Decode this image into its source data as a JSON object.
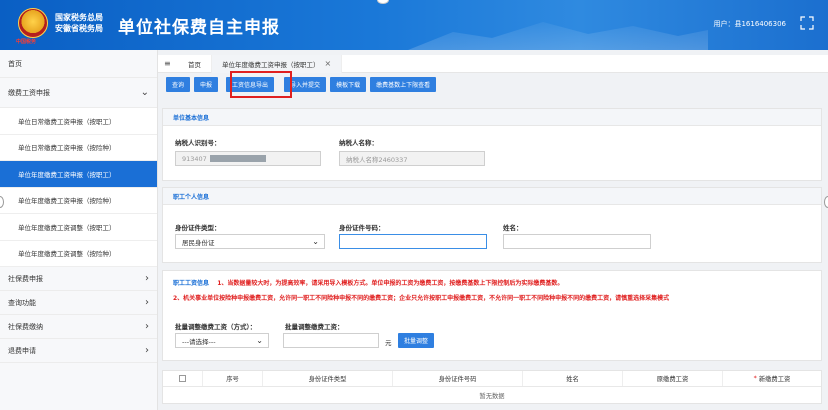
{
  "header": {
    "org_line1": "国家税务总局",
    "org_line2": "安徽省税务局",
    "emblem_subtitle": "中国税务",
    "title": "单位社保费自主申报",
    "user": "用户：县1616406306"
  },
  "sidebar": {
    "home": "首页",
    "group_title": "缴费工资申报",
    "sub_items": [
      "单位日常缴费工资申报（按职工）",
      "单位日常缴费工资申报（按险种）",
      "单位年度缴费工资申报（按职工）",
      "单位年度缴费工资申报（按险种）",
      "单位年度缴费工资调整（按职工）",
      "单位年度缴费工资调整（按险种）"
    ],
    "active_index": 2,
    "collapsed_groups": [
      "社保费申报",
      "查询功能",
      "社保费缴纳",
      "退费申请"
    ]
  },
  "tabs": {
    "home": "首页",
    "active": "单位年度缴费工资申报（按职工）"
  },
  "toolbar": {
    "buttons": [
      "查询",
      "申报",
      "工资信息导出",
      "导入并提交",
      "模板下载",
      "缴费基数上下限查看"
    ],
    "highlighted": "工资信息导出"
  },
  "unit_info": {
    "title": "单位基本信息",
    "taxpayer_id_label": "纳税人识别号：",
    "taxpayer_id_value": "913407",
    "taxpayer_name_label": "纳税人名称：",
    "taxpayer_name_placeholder": "纳税人名称2460337"
  },
  "personal_info": {
    "title": "职工个人信息",
    "id_type_label": "身份证件类型：",
    "id_type_value": "居民身份证",
    "id_no_label": "身份证件号码：",
    "name_label": "姓名："
  },
  "wage_info": {
    "title": "职工工资信息",
    "notice1": "1、当数据量较大时，为提高效率，请采用导入模板方式。单位申报的工资为缴费工资，按缴费基数上下限控制后为实际缴费基数。",
    "notice2": "2、机关事业单位按险种申报缴费工资，允许同一职工不同险种申报不同的缴费工资；企业只允许按职工申报缴费工资，不允许同一职工不同险种申报不同的缴费工资，请慎重选择采集模式",
    "batch_mode_label": "批量调整缴费工资（方式）：",
    "batch_mode_value": "---请选择---",
    "batch_wage_label": "批量调整缴费工资：",
    "unit": "元",
    "batch_button": "批量调整"
  },
  "table": {
    "columns": [
      "序号",
      "身份证件类型",
      "身份证件号码",
      "姓名",
      "原缴费工资",
      "新缴费工资"
    ],
    "required_column": "新缴费工资",
    "empty_text": "暂无数据"
  },
  "colors": {
    "header_blue": "#1a78d8",
    "active_blue": "#1a6fd6",
    "button_blue": "#2f7fe0",
    "notice_red": "#e02020"
  }
}
